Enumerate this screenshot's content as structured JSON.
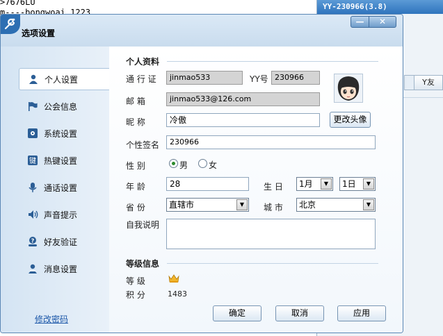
{
  "background": {
    "line1": ">7676LU",
    "line2": "m----bongwoai 1223",
    "right_title": "YY-230966(3.8)",
    "right_button": "Y友"
  },
  "dialog": {
    "title": "选项设置",
    "minimize": "—",
    "close": "✕"
  },
  "sidebar": {
    "items": [
      {
        "label": "个人设置",
        "icon": "user-icon"
      },
      {
        "label": "公会信息",
        "icon": "flag-icon"
      },
      {
        "label": "系统设置",
        "icon": "settings-icon"
      },
      {
        "label": "热键设置",
        "icon": "hotkey-icon"
      },
      {
        "label": "通话设置",
        "icon": "microphone-icon"
      },
      {
        "label": "声音提示",
        "icon": "speaker-icon"
      },
      {
        "label": "好友验证",
        "icon": "question-user-icon"
      },
      {
        "label": "消息设置",
        "icon": "message-user-icon"
      }
    ],
    "change_password": "修改密码"
  },
  "profile": {
    "section_title": "个人资料",
    "passport_label": "通 行 证",
    "passport_value": "jinmao533",
    "yy_label": "YY号",
    "yy_value": "230966",
    "email_label": "邮    箱",
    "email_value": "jinmao533@126.com",
    "nickname_label": "昵    称",
    "nickname_value": "冷傲",
    "change_avatar": "更改头像",
    "signature_label": "个性签名",
    "signature_value": "230966",
    "gender_label": "性    别",
    "gender_male": "男",
    "gender_female": "女",
    "age_label": "年    龄",
    "age_value": "28",
    "birthday_label": "生  日",
    "birth_month": "1月",
    "birth_day": "1日",
    "province_label": "省    份",
    "province_value": "直辖市",
    "city_label": "城  市",
    "city_value": "北京",
    "intro_label": "自我说明"
  },
  "level": {
    "section_title": "等级信息",
    "level_label": "等    级",
    "points_label": "积    分",
    "points_value": "1483"
  },
  "buttons": {
    "ok": "确定",
    "cancel": "取消",
    "apply": "应用"
  },
  "colors": {
    "accent": "#2d6fb3",
    "sidebar_bg": "#d4e4f3",
    "readonly_field": "#d4d4d4",
    "link": "#1a56a8"
  }
}
